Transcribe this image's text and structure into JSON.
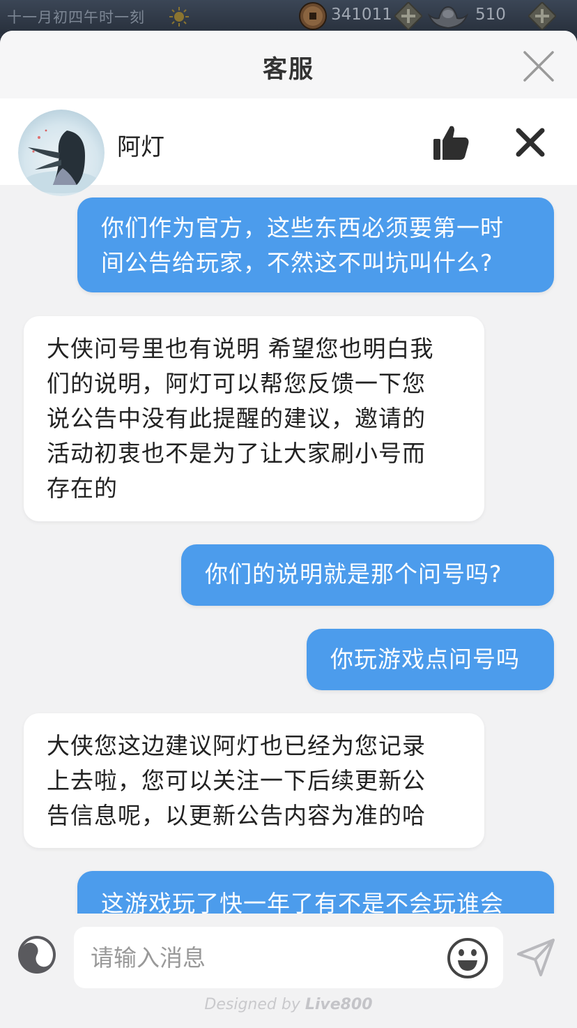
{
  "game_bar": {
    "time_text": "十一月初四午时一刻",
    "coin_value": "341011",
    "ingot_value": "510",
    "icons": [
      "sun-icon",
      "coin-icon",
      "plus-icon",
      "ingot-icon"
    ]
  },
  "panel": {
    "title": "客服"
  },
  "agent": {
    "name": "阿灯"
  },
  "messages": [
    {
      "from": "user",
      "text": "你们作为官方，这些东西必须要第一时\n间公告给玩家，不然这不叫坑叫什么?"
    },
    {
      "from": "agent",
      "text": "大侠问号里也有说明 希望您也明白我\n们的说明，阿灯可以帮您反馈一下您\n说公告中没有此提醒的建议，邀请的\n活动初衷也不是为了让大家刷小号而\n存在的"
    },
    {
      "from": "user",
      "text": "你们的说明就是那个问号吗?"
    },
    {
      "from": "user",
      "text": "你玩游戏点问号吗"
    },
    {
      "from": "agent",
      "text": "大侠您这边建议阿灯也已经为您记录\n上去啦，您可以关注一下后续更新公\n告信息呢，以更新公告内容为准的哈"
    },
    {
      "from": "user",
      "text": "这游戏玩了快一年了有不是不会玩谁会"
    }
  ],
  "input": {
    "placeholder": "请输入消息",
    "value": ""
  },
  "footer": {
    "prefix": "Designed by ",
    "brand": "Live800"
  },
  "colors": {
    "user_bubble": "#4c9cec",
    "agent_bubble": "#ffffff",
    "panel_bg": "#f2f2f3"
  }
}
